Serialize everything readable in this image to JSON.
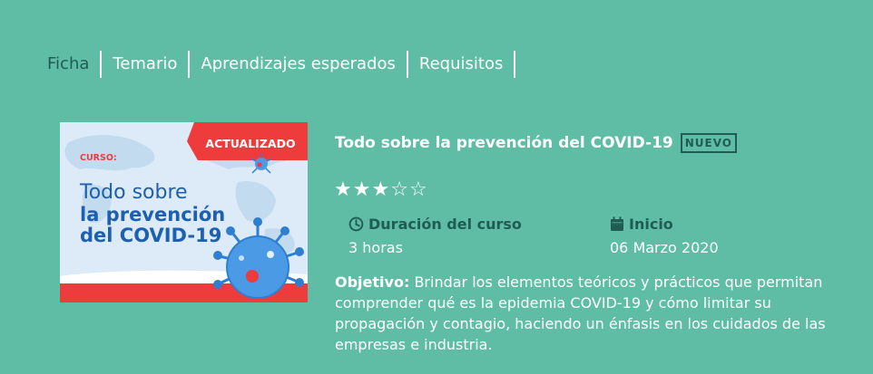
{
  "tabs": [
    {
      "label": "Ficha",
      "active": true
    },
    {
      "label": "Temario",
      "active": false
    },
    {
      "label": "Aprendizajes esperados",
      "active": false
    },
    {
      "label": "Requisitos",
      "active": false
    }
  ],
  "thumbnail": {
    "ribbon": "ACTUALIZADO",
    "kicker": "CURSO:",
    "line1": "Todo sobre",
    "line2": "la prevención",
    "line3": "del COVID-19"
  },
  "course": {
    "title": "Todo sobre la prevención del COVID-19",
    "badge": "NUEVO",
    "rating": 3,
    "rating_max": 5,
    "duration_label": "Duración del curso",
    "duration_value": "3 horas",
    "start_label": "Inicio",
    "start_value": "06 Marzo 2020",
    "objective_label": "Objetivo:",
    "objective_text": "Brindar los elementos teóricos y prácticos que permitan comprender qué es la epidemia COVID-19 y cómo limitar su propagación y contagio, haciendo un énfasis en los cuidados de las empresas e industria."
  },
  "colors": {
    "background": "#5fbda6",
    "dark_text": "#1f5c52",
    "ribbon_red": "#ee3b3b",
    "thumb_title_blue": "#1d5fb0"
  },
  "icons": [
    "clock-icon",
    "calendar-icon",
    "star-icon",
    "virus-icon"
  ]
}
